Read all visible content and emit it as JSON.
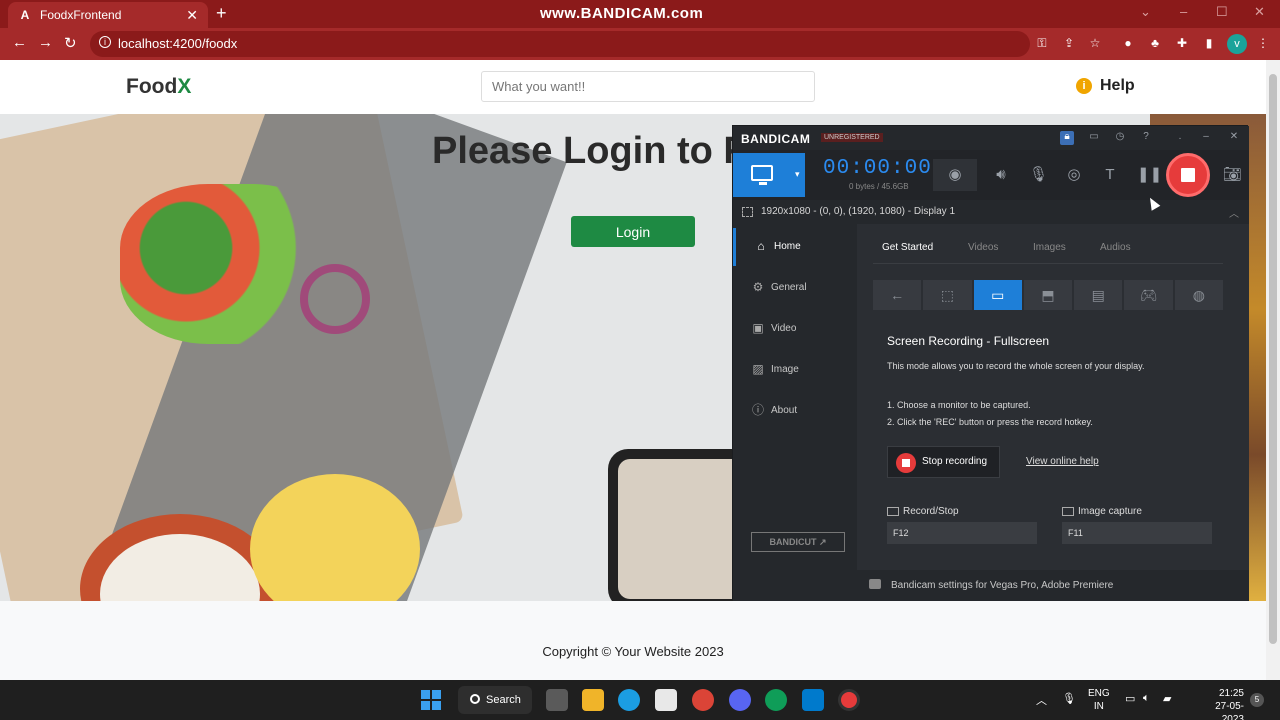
{
  "browser": {
    "tab_title": "FoodxFrontend",
    "tab_favicon": "A",
    "new_tab": "+",
    "url": "localhost:4200/foodx",
    "profile_initial": "v",
    "watermark": "www.BANDICAM.com"
  },
  "site": {
    "logo_text": "Food",
    "logo_accent": "X",
    "search_placeholder": "What you want!!",
    "help_label": "Help",
    "hero_title": "Please Login to F",
    "login_label": "Login",
    "copyright": "Copyright © Your Website 2023"
  },
  "bandicam": {
    "brand": "BANDICAM",
    "unregistered": "UNREGISTERED",
    "timer": "00:00:00",
    "size": "0 bytes / 45.6GB",
    "display_info": "1920x1080 - (0, 0), (1920, 1080) - Display 1",
    "sidebar": [
      "Home",
      "General",
      "Video",
      "Image",
      "About"
    ],
    "bandicut": "BANDICUT ↗",
    "tabs": [
      "Get Started",
      "Videos",
      "Images",
      "Audios"
    ],
    "heading": "Screen Recording - Fullscreen",
    "description": "This mode allows you to record the whole screen of your display.",
    "step1": "1. Choose a monitor to be captured.",
    "step2": "2. Click the 'REC' button or press the record hotkey.",
    "stop_label": "Stop recording",
    "help_link": "View online help",
    "hotkey_record_label": "Record/Stop",
    "hotkey_record_value": "F12",
    "hotkey_image_label": "Image capture",
    "hotkey_image_value": "F11",
    "bottom_text": "Bandicam settings for Vegas Pro, Adobe Premiere"
  },
  "taskbar": {
    "search_label": "Search",
    "lang_line1": "ENG",
    "lang_line2": "IN",
    "time": "21:25",
    "date": "27-05-2023",
    "notifications": "5"
  },
  "colors": {
    "browser_frame": "#8b1a1a",
    "brand_green": "#1e8a43",
    "bandicam_blue": "#1e7fd8",
    "record_red": "#e63b3b"
  }
}
